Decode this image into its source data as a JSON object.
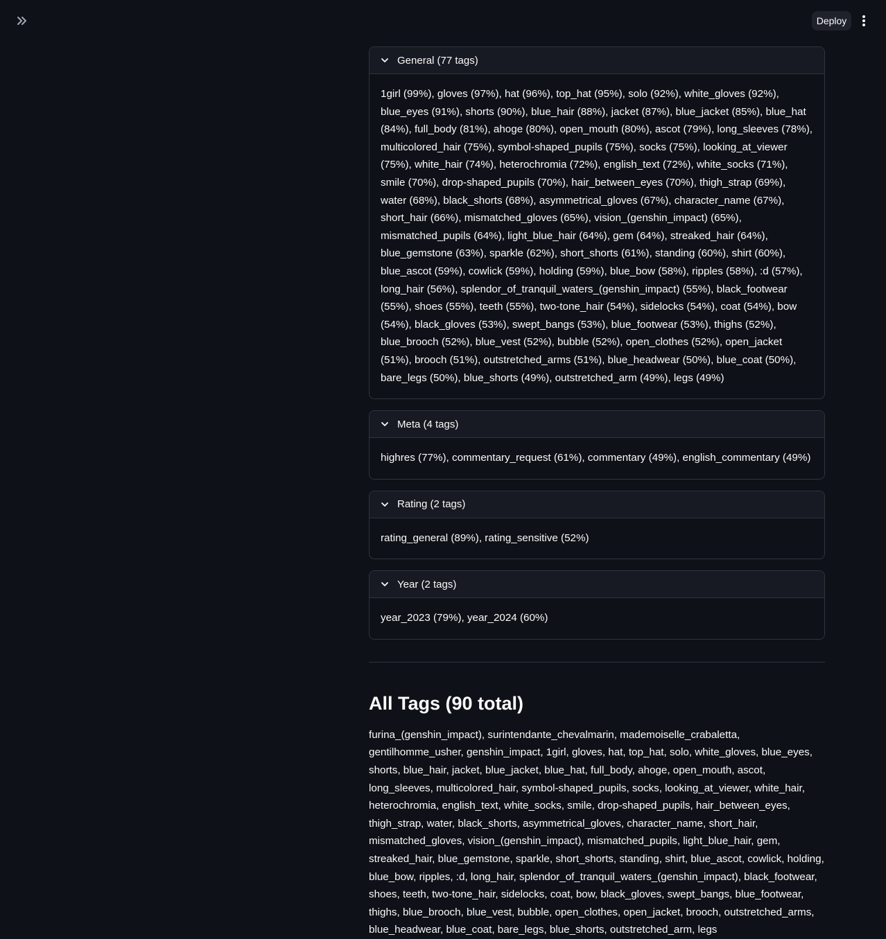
{
  "header": {
    "deploy_label": "Deploy"
  },
  "sections": [
    {
      "title": "General (77 tags)",
      "content": "1girl (99%), gloves (97%), hat (96%), top_hat (95%), solo (92%), white_gloves (92%), blue_eyes (91%), shorts (90%), blue_hair (88%), jacket (87%), blue_jacket (85%), blue_hat (84%), full_body (81%), ahoge (80%), open_mouth (80%), ascot (79%), long_sleeves (78%), multicolored_hair (75%), symbol-shaped_pupils (75%), socks (75%), looking_at_viewer (75%), white_hair (74%), heterochromia (72%), english_text (72%), white_socks (71%), smile (70%), drop-shaped_pupils (70%), hair_between_eyes (70%), thigh_strap (69%), water (68%), black_shorts (68%), asymmetrical_gloves (67%), character_name (67%), short_hair (66%), mismatched_gloves (65%), vision_(genshin_impact) (65%), mismatched_pupils (64%), light_blue_hair (64%), gem (64%), streaked_hair (64%), blue_gemstone (63%), sparkle (62%), short_shorts (61%), standing (60%), shirt (60%), blue_ascot (59%), cowlick (59%), holding (59%), blue_bow (58%), ripples (58%), :d (57%), long_hair (56%), splendor_of_tranquil_waters_(genshin_impact) (55%), black_footwear (55%), shoes (55%), teeth (55%), two-tone_hair (54%), sidelocks (54%), coat (54%), bow (54%), black_gloves (53%), swept_bangs (53%), blue_footwear (53%), thighs (52%), blue_brooch (52%), blue_vest (52%), bubble (52%), open_clothes (52%), open_jacket (51%), brooch (51%), outstretched_arms (51%), blue_headwear (50%), blue_coat (50%), bare_legs (50%), blue_shorts (49%), outstretched_arm (49%), legs (49%)"
    },
    {
      "title": "Meta (4 tags)",
      "content": "highres (77%), commentary_request (61%), commentary (49%), english_commentary (49%)"
    },
    {
      "title": "Rating (2 tags)",
      "content": "rating_general (89%), rating_sensitive (52%)"
    },
    {
      "title": "Year (2 tags)",
      "content": "year_2023 (79%), year_2024 (60%)"
    }
  ],
  "all_tags": {
    "title": "All Tags (90 total)",
    "content": "furina_(genshin_impact), surintendante_chevalmarin, mademoiselle_crabaletta, gentilhomme_usher, genshin_impact, 1girl, gloves, hat, top_hat, solo, white_gloves, blue_eyes, shorts, blue_hair, jacket, blue_jacket, blue_hat, full_body, ahoge, open_mouth, ascot, long_sleeves, multicolored_hair, symbol-shaped_pupils, socks, looking_at_viewer, white_hair, heterochromia, english_text, white_socks, smile, drop-shaped_pupils, hair_between_eyes, thigh_strap, water, black_shorts, asymmetrical_gloves, character_name, short_hair, mismatched_gloves, vision_(genshin_impact), mismatched_pupils, light_blue_hair, gem, streaked_hair, blue_gemstone, sparkle, short_shorts, standing, shirt, blue_ascot, cowlick, holding, blue_bow, ripples, :d, long_hair, splendor_of_tranquil_waters_(genshin_impact), black_footwear, shoes, teeth, two-tone_hair, sidelocks, coat, bow, black_gloves, swept_bangs, blue_footwear, thighs, blue_brooch, blue_vest, bubble, open_clothes, open_jacket, brooch, outstretched_arms, blue_headwear, blue_coat, bare_legs, blue_shorts, outstretched_arm, legs"
  }
}
